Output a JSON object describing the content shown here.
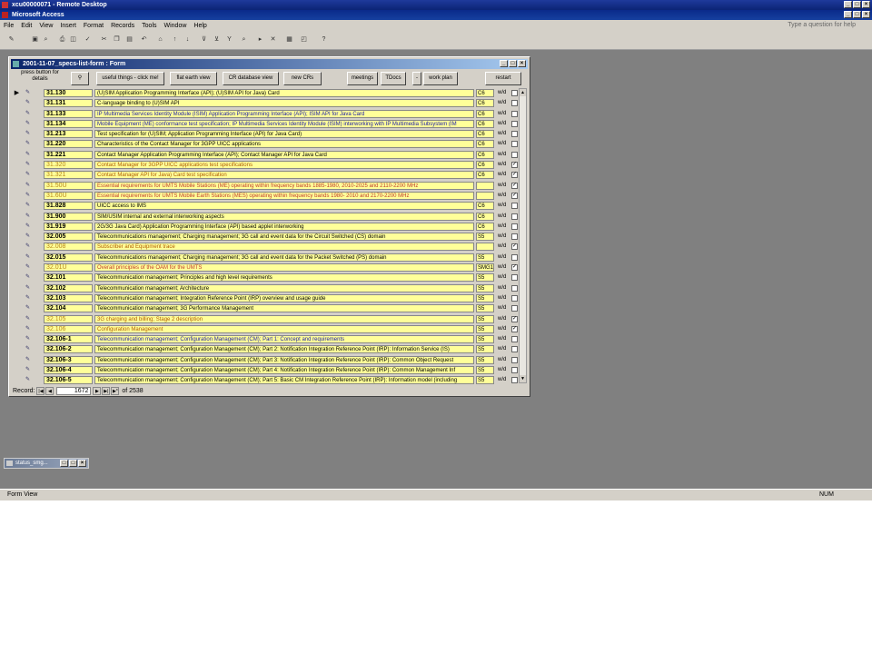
{
  "remote_title": "xcu00000071 - Remote Desktop",
  "access_title": "Microsoft Access",
  "menu": [
    "File",
    "Edit",
    "View",
    "Insert",
    "Format",
    "Records",
    "Tools",
    "Window",
    "Help"
  ],
  "question_placeholder": "Type a question for help",
  "form": {
    "title": "2001-11-07_specs-list-form : Form",
    "press_label": "press button for details",
    "buttons": {
      "useful": "useful things - click me!",
      "flat": "flat earth view",
      "cr_db": "CR database view",
      "new_crs": "new CRs",
      "meetings": "meetings",
      "tdocs": "TDocs",
      "work_plan": "work plan",
      "restart": "restart"
    }
  },
  "rows": [
    {
      "num": "31.130",
      "title": "(U)SIM Application Programming Interface (API); (U)SIM API for Java) Card",
      "wg": "C6",
      "wd": "w/d",
      "checked": false,
      "style": "normal",
      "current": true
    },
    {
      "num": "31.131",
      "title": "C-language binding to (U)SIM API",
      "wg": "C6",
      "wd": "w/d",
      "checked": false,
      "style": "normal"
    },
    {
      "num": "31.133",
      "title": "IP Multimedia Services Identity Module (ISIM) Application Programming Interface (API); ISIM API for Java Card",
      "wg": "C6",
      "wd": "w/d",
      "checked": false,
      "style": "blue"
    },
    {
      "num": "31.134",
      "title": "Mobile Equipment (ME) conformance test specification; IP Multimedia Services Identity Module (ISIM) interworking with IP Multimedia Subsystem (IM",
      "wg": "C6",
      "wd": "w/d",
      "checked": false,
      "style": "blue"
    },
    {
      "num": "31.213",
      "title": "Test specification for (U)SIM; Application Programming Interface (API) for Java Card)",
      "wg": "C6",
      "wd": "w/d",
      "checked": false,
      "style": "normal"
    },
    {
      "num": "31.220",
      "title": "Characteristics of the Contact Manager for 3GPP UICC applications",
      "wg": "C6",
      "wd": "w/d",
      "checked": false,
      "style": "normal"
    },
    {
      "num": "31.221",
      "title": "Contact Manager Application Programming Interface (API); Contact Manager API for Java Card",
      "wg": "C6",
      "wd": "w/d",
      "checked": false,
      "style": "normal"
    },
    {
      "num": "31.320",
      "title": "Contact Manager for 3GPP UICC applications test specifications",
      "wg": "C6",
      "wd": "w/d",
      "checked": true,
      "style": "withdrawn"
    },
    {
      "num": "31.321",
      "title": "Contact Manager API for Java) Card test specification",
      "wg": "C6",
      "wd": "w/d",
      "checked": true,
      "style": "withdrawn"
    },
    {
      "num": "31.50U",
      "title": "Essential requirements for UMTS Mobile Stations (ME) operating within frequency bands 1885-1980, 2010-2025 and 2110-2200 MHz",
      "wg": "",
      "wd": "w/d",
      "checked": true,
      "style": "red"
    },
    {
      "num": "31.60U",
      "title": "Essential requirements for UMTS Mobile Earth Stations (MES) operating within frequency bands 1980- 2010 and 2170-2200 MHz",
      "wg": "",
      "wd": "w/d",
      "checked": true,
      "style": "red"
    },
    {
      "num": "31.828",
      "title": "UICC access to IMS",
      "wg": "C6",
      "wd": "w/d",
      "checked": false,
      "style": "normal"
    },
    {
      "num": "31.900",
      "title": "SIM/USIM internal and external interworking aspects",
      "wg": "C6",
      "wd": "w/d",
      "checked": false,
      "style": "normal"
    },
    {
      "num": "31.919",
      "title": "2G/3G Java Card) Application Programming Interface (API) based applet interworking",
      "wg": "C6",
      "wd": "w/d",
      "checked": false,
      "style": "normal"
    },
    {
      "num": "32.005",
      "title": "Telecommunications management; Charging management; 3G call and event data for the Circuit Switched (CS) domain",
      "wg": "S5",
      "wd": "w/d",
      "checked": false,
      "style": "normal"
    },
    {
      "num": "32.008",
      "title": "Subscriber and Equipment trace",
      "wg": "",
      "wd": "w/d",
      "checked": true,
      "style": "withdrawn"
    },
    {
      "num": "32.015",
      "title": "Telecommunications management; Charging management; 3G call and event data for the Packet Switched (PS) domain",
      "wg": "S5",
      "wd": "w/d",
      "checked": false,
      "style": "normal"
    },
    {
      "num": "32.01U",
      "title": "Overall principles of the OAM for the UMTS",
      "wg": "SMG1",
      "wd": "w/d",
      "checked": true,
      "style": "red"
    },
    {
      "num": "32.101",
      "title": "Telecommunication management; Principles and high level requirements",
      "wg": "S5",
      "wd": "w/d",
      "checked": false,
      "style": "normal"
    },
    {
      "num": "32.102",
      "title": "Telecommunication management; Architecture",
      "wg": "S5",
      "wd": "w/d",
      "checked": false,
      "style": "normal"
    },
    {
      "num": "32.103",
      "title": "Telecommunication management; Integration Reference Point (IRP) overview and usage guide",
      "wg": "S5",
      "wd": "w/d",
      "checked": false,
      "style": "normal"
    },
    {
      "num": "32.104",
      "title": "Telecommunication management; 3G Performance Management",
      "wg": "S5",
      "wd": "w/d",
      "checked": false,
      "style": "normal"
    },
    {
      "num": "32.105",
      "title": "3G charging and billing; Stage 2 description",
      "wg": "S5",
      "wd": "w/d",
      "checked": true,
      "style": "withdrawn"
    },
    {
      "num": "32.106",
      "title": "Configuration Management",
      "wg": "S5",
      "wd": "w/d",
      "checked": true,
      "style": "withdrawn"
    },
    {
      "num": "32.106-1",
      "title": "Telecommunication management; Configuration Management (CM); Part 1: Concept and requirements",
      "wg": "S5",
      "wd": "w/d",
      "checked": false,
      "style": "blue"
    },
    {
      "num": "32.106-2",
      "title": "Telecommunication management; Configuration Management (CM); Part 2: Notification Integration Reference Point (IRP): Information Service (IS)",
      "wg": "S5",
      "wd": "w/d",
      "checked": false,
      "style": "normal"
    },
    {
      "num": "32.106-3",
      "title": "Telecommunication management; Configuration Management (CM); Part 3: Notification Integration Reference Point (IRP): Common Object Request",
      "wg": "S5",
      "wd": "w/d",
      "checked": false,
      "style": "normal"
    },
    {
      "num": "32.106-4",
      "title": "Telecommunication management; Configuration Management (CM); Part 4: Notification Integration Reference Point (IRP): Common Management Inf",
      "wg": "S5",
      "wd": "w/d",
      "checked": false,
      "style": "normal"
    },
    {
      "num": "32.106-5",
      "title": "Telecommunication management; Configuration Management (CM); Part 5: Basic CM Integration Reference Point (IRP): Information model (including",
      "wg": "S5",
      "wd": "w/d",
      "checked": false,
      "style": "normal"
    }
  ],
  "record": {
    "label": "Record:",
    "current": "1672",
    "of_label": "of",
    "total": "2538"
  },
  "minimized_title": "status_smg...",
  "status": {
    "left": "Form View",
    "right": "NUM"
  }
}
